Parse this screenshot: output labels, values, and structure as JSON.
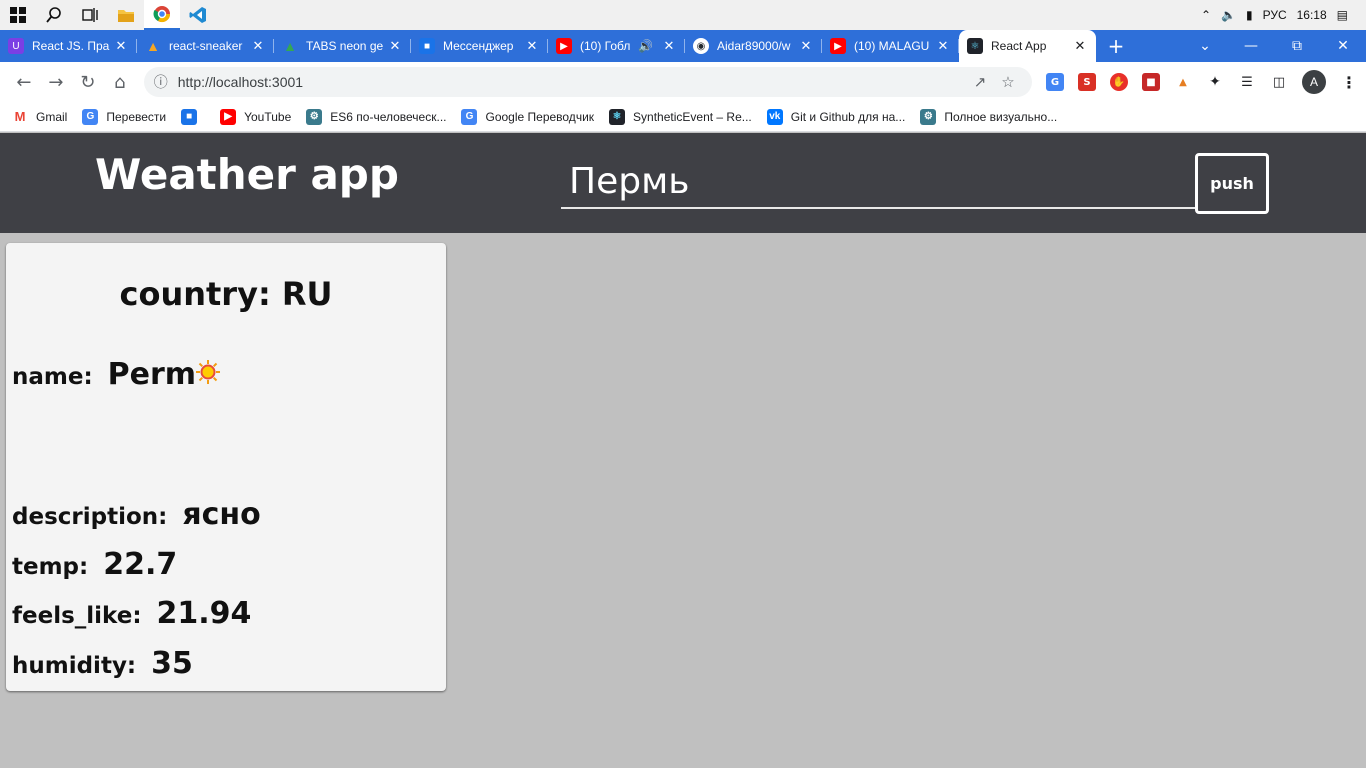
{
  "taskbar": {
    "lang": "РУС",
    "time": "16:18"
  },
  "tabs": [
    {
      "title": "React JS. Пра",
      "icon": "react-course-favicon",
      "color": "#7b3fe4"
    },
    {
      "title": "react-sneaker",
      "icon": "firebase-favicon",
      "color": "#f5a623"
    },
    {
      "title": "TABS neon ge",
      "icon": "google-drive-favicon",
      "color": "#34a853"
    },
    {
      "title": "Мессенджер",
      "icon": "messenger-favicon",
      "color": "#1a73e8"
    },
    {
      "title": "(10) Гобл",
      "icon": "youtube-favicon",
      "color": "#ff0000"
    },
    {
      "title": "Aidar89000/w",
      "icon": "github-favicon",
      "color": "#24292e"
    },
    {
      "title": "(10) MALAGU",
      "icon": "youtube-favicon",
      "color": "#ff0000"
    },
    {
      "title": "React App",
      "icon": "react-favicon",
      "color": "#20232a"
    }
  ],
  "address_bar": {
    "url": "http://localhost:3001"
  },
  "bookmarks": [
    {
      "label": "Gmail",
      "color": "#ea4335"
    },
    {
      "label": "Перевести",
      "color": "#4285f4"
    },
    {
      "label": "",
      "color": "#1a73e8"
    },
    {
      "label": "YouTube",
      "color": "#ff0000"
    },
    {
      "label": "ES6 по-человечеcк...",
      "color": "#3a7a8c"
    },
    {
      "label": "Google Переводчик",
      "color": "#4285f4"
    },
    {
      "label": "SyntheticEvent – Re...",
      "color": "#20232a"
    },
    {
      "label": "Git и Github для на...",
      "color": "#0077ff"
    },
    {
      "label": "Полное визуально...",
      "color": "#3a7a8c"
    }
  ],
  "app": {
    "title": "Weather app",
    "search_value": "Пермь",
    "push_label": "push",
    "card": {
      "country_label": "country:",
      "country": "RU",
      "name_label": "name:",
      "name": "Perm",
      "weather_icon": "sun-icon",
      "description_label": "description:",
      "description": "ясно",
      "temp_label": "temp:",
      "temp": "22.7",
      "feels_like_label": "feels_like:",
      "feels_like": "21.94",
      "humidity_label": "humidity:",
      "humidity": "35"
    }
  }
}
